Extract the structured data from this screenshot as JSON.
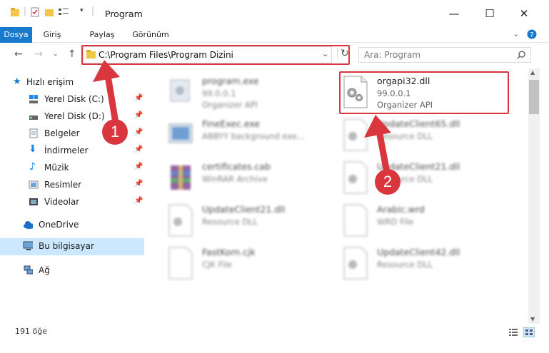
{
  "window": {
    "title": "Program"
  },
  "ribbon": {
    "tabs": [
      "Dosya",
      "Giriş",
      "Paylaş",
      "Görünüm"
    ]
  },
  "address": {
    "path": "C:\\Program Files\\Program Dizini"
  },
  "search": {
    "placeholder": "Ara: Program"
  },
  "sidebar": {
    "quick_access": "Hızlı erişim",
    "items": [
      "Yerel Disk (C:)",
      "Yerel Disk (D:)",
      "Belgeler",
      "İndirmeler",
      "Müzik",
      "Resimler",
      "Videolar"
    ],
    "onedrive": "OneDrive",
    "this_pc": "Bu bilgisayar",
    "network": "Ağ"
  },
  "files": [
    {
      "name": "program.exe",
      "version": "99.0.0.1",
      "desc": "Organizer API"
    },
    {
      "name": "orgapi32.dll",
      "version": "99.0.0.1",
      "desc": "Organizer API"
    },
    {
      "name": "FineExec.exe",
      "version": "ABBYY background exe...",
      "desc": ""
    },
    {
      "name": "UpdateClient65.dll",
      "version": "Resource DLL",
      "desc": ""
    },
    {
      "name": "certificates.cab",
      "version": "WinRAR Archive",
      "desc": ""
    },
    {
      "name": "UpdateClient21.dll",
      "version": "Resource DLL",
      "desc": ""
    },
    {
      "name": "UpdateClient21.dll",
      "version": "Resource DLL",
      "desc": ""
    },
    {
      "name": "Arabic.wrd",
      "version": "WRD File",
      "desc": ""
    },
    {
      "name": "FastKorn.cjk",
      "version": "CJK File",
      "desc": ""
    },
    {
      "name": "UpdateClient42.dll",
      "version": "Resource DLL",
      "desc": ""
    }
  ],
  "status": {
    "count": "191 öğe"
  },
  "annotations": {
    "badge1": "1",
    "badge2": "2"
  },
  "colors": {
    "accent": "#1979ca",
    "highlight": "#d9363e",
    "selected": "#cce8ff"
  }
}
